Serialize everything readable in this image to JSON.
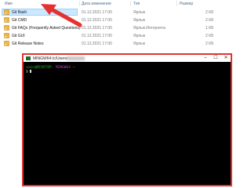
{
  "explorer": {
    "columns": {
      "name": "Имя",
      "date": "Дата изменения",
      "type": "Тип",
      "size": "Размер"
    },
    "files": [
      {
        "name": "Git Bash",
        "date": "01.12.2021 17:00",
        "type": "Ярлык",
        "size": "2 КБ",
        "selected": true
      },
      {
        "name": "Git CMD",
        "date": "01.12.2021 17:00",
        "type": "Ярлык",
        "size": "2 КБ"
      },
      {
        "name": "Git FAQs (Frequently Asked Questions)",
        "date": "01.12.2021 17:00",
        "type": "Ярлык Интернета",
        "size": "1 КБ"
      },
      {
        "name": "Git GUI",
        "date": "01.12.2021 17:00",
        "type": "Ярлык",
        "size": "2 КБ"
      },
      {
        "name": "Git Release Notes",
        "date": "01.12.2021 17:00",
        "type": "Ярлык",
        "size": "2 КБ"
      }
    ]
  },
  "terminal": {
    "title": "MINGW64:/c/Users/",
    "buttons": {
      "minimize": "–",
      "maximize": "☐",
      "close": "✕"
    },
    "prompt": {
      "user": "user@DESKTOP-",
      "system": "MINGW64",
      "path": "~",
      "symbol": "$"
    },
    "border_color": "#e5312f"
  }
}
